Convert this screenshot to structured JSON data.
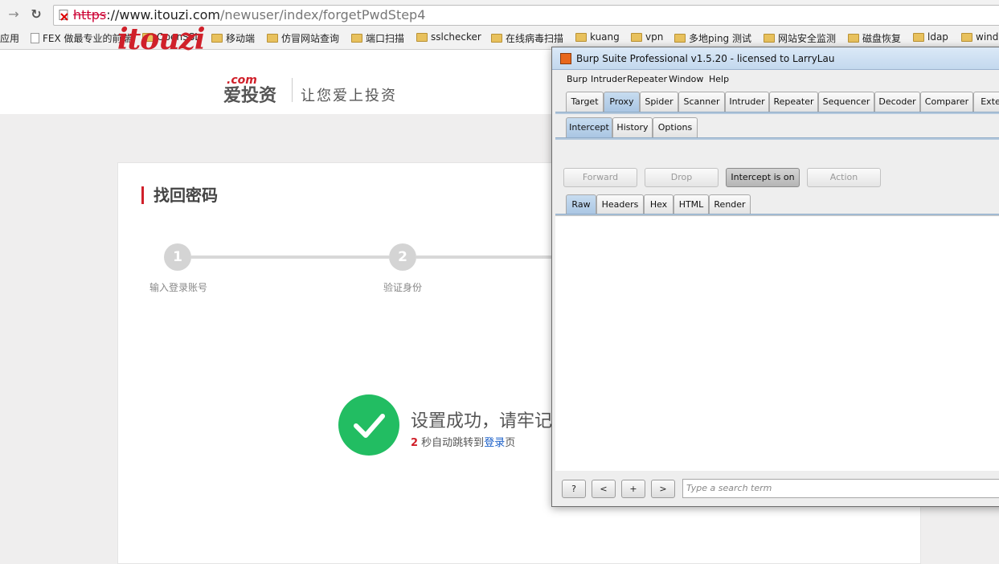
{
  "browser": {
    "url_scheme": "https",
    "url_host": "://www.itouzi.com",
    "url_path": "/newuser/index/forgetPwdStep4",
    "bookmarks": [
      "应用",
      "FEX 做最专业的前端",
      "OpenSSL",
      "移动端",
      "仿冒网站查询",
      "端口扫描",
      "sslchecker",
      "在线病毒扫描",
      "kuang",
      "vpn",
      "多地ping 测试",
      "网站安全监测",
      "磁盘恢复",
      "ldap",
      "wind"
    ]
  },
  "site": {
    "logo_text": "itouzi",
    "logo_com": ".com",
    "logo_cn": "爱投资",
    "slogan": "让您爱上投资",
    "card_title": "找回密码",
    "steps": [
      {
        "number": "1",
        "label": "输入登录账号"
      },
      {
        "number": "2",
        "label": "验证身份"
      }
    ],
    "success_message": "设置成功，请牢记",
    "redirect": {
      "count": "2",
      "prefix": " 秒自动跳转到",
      "link": "登录",
      "suffix": "页"
    }
  },
  "burp": {
    "title": "Burp Suite Professional v1.5.20 - licensed to LarryLau",
    "menu": [
      "Burp",
      "Intruder",
      "Repeater",
      "Window",
      "Help"
    ],
    "main_tabs": [
      "Target",
      "Proxy",
      "Spider",
      "Scanner",
      "Intruder",
      "Repeater",
      "Sequencer",
      "Decoder",
      "Comparer",
      "Exten"
    ],
    "active_main_tab": "Proxy",
    "proxy_tabs": [
      "Intercept",
      "History",
      "Options"
    ],
    "active_proxy_tab": "Intercept",
    "buttons": {
      "forward": "Forward",
      "drop": "Drop",
      "intercept": "Intercept is on",
      "action": "Action"
    },
    "message_tabs": [
      "Raw",
      "Headers",
      "Hex",
      "HTML",
      "Render"
    ],
    "active_message_tab": "Raw",
    "bottom": {
      "help": "?",
      "prev": "<",
      "add": "+",
      "next": ">",
      "search_placeholder": "Type a search term"
    }
  }
}
